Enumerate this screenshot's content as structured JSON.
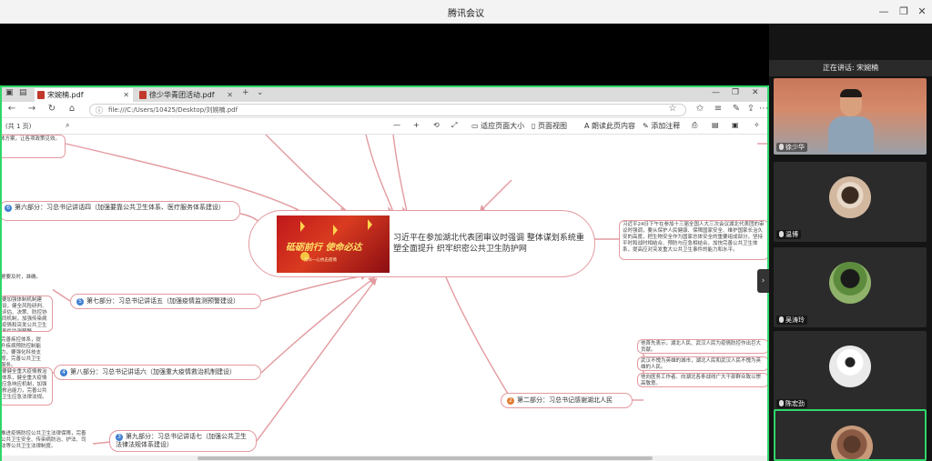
{
  "meeting": {
    "title": "腾讯会议",
    "speaking_label": "正在讲话: 宋婉楠"
  },
  "browser": {
    "tabs": [
      {
        "label": "宋婉楠.pdf",
        "active": true
      },
      {
        "label": "徐少华青团活动.pdf",
        "active": false
      }
    ],
    "url": "file:///C:/Users/10425/Desktop/刘婉楠.pdf"
  },
  "pdf_toolbar": {
    "page_indicator": "(共 1 页)",
    "fit_label": "适应页面大小",
    "page_view_label": "页面视图",
    "read_aloud_label": "朗读此页内容",
    "annotate_label": "添加注释"
  },
  "mindmap": {
    "center_text": "习近平在参加湖北代表团审议时强调 整体谋划系统重塑全面提升 织牢织密公共卫生防护网",
    "center_image": {
      "slogan": "砥砺前行  使命必达",
      "subtitle": "万众一心抗击疫情"
    },
    "nodes": [
      {
        "num": "6",
        "label": "第六部分：习总书记讲话四（加强要靠公共卫生体系、医疗服务体系建设）",
        "color": "blue"
      },
      {
        "num": "5",
        "label": "第七部分：习总书记讲话五（加强疫情监测预警建设）",
        "color": "blue"
      },
      {
        "num": "4",
        "label": "第八部分：习总书记讲话六（加强重大疫情救治机制建设）",
        "color": "blue"
      },
      {
        "num": "3",
        "label": "第九部分：习总书记讲话七（加强公共卫生法律法规体系建设）",
        "color": "blue"
      },
      {
        "num": "2",
        "label": "第二部分：习总书记感谢湖北人民",
        "color": "orange"
      }
    ],
    "notes": {
      "top_left": "体方案，让各项政策见效。",
      "right_summary": "习近平24日下午在参加十三届全国人大三次会议湖北代表团的审议时强调，要从保护人民健康、保障国家安全、维护国家长治久安的高度，把生物安全作为国家总体安全的重要组成部分，坚持平时和战时相结合、预防与应急相结合，加快完善公共卫生体系，提高应对突发重大公共卫生事件的能力和水平。",
      "right_item_1": "他首先表示，湖北人民、武汉人民为疫情防控作出巨大贡献。",
      "right_item_2": "武汉不愧为英雄的城市，湖北人民和武汉人民不愧为英雄的人民。",
      "right_item_3": "他向医务工作者、向湖北各条战线广大干部群众致以崇高敬意。",
      "left_1": "警要及时，准确。",
      "left_2": "要加强体制机制建设，健全风险研判、评估、决策、防控协同机制，加强传染病疫情和突发公共卫生事件监测预警。",
      "left_3": "要健全统一的应急物资保障体系，完善公共卫生重大风险研判、评估、决策、防控协同机制，加强一线医务人员。",
      "left_4": "要健全重大疫情救治体系，健全重大疫情应急响应机制，加强救治能力，完善公共卫生应急法律法规。",
      "left_5": "完善疾控体系，提升疾病预防控制能力，要强化科技支撑，完善公共卫生服务。",
      "left_6": "推进疫情防控公共卫生法律保障，完善公共卫生安全、传染病防治、护法、司法等公共卫生法律制度。"
    }
  },
  "participants": [
    {
      "name": "徐少华",
      "type": "video"
    },
    {
      "name": "温博",
      "type": "avatar"
    },
    {
      "name": "吴涛玲",
      "type": "avatar"
    },
    {
      "name": "陈宏劲",
      "type": "avatar"
    },
    {
      "name": "",
      "type": "avatar"
    }
  ],
  "colors": {
    "accent_green": "#2fd76a",
    "node_border": "#e39aa0",
    "num_blue": "#3f7fd0",
    "num_orange": "#e07b32"
  }
}
